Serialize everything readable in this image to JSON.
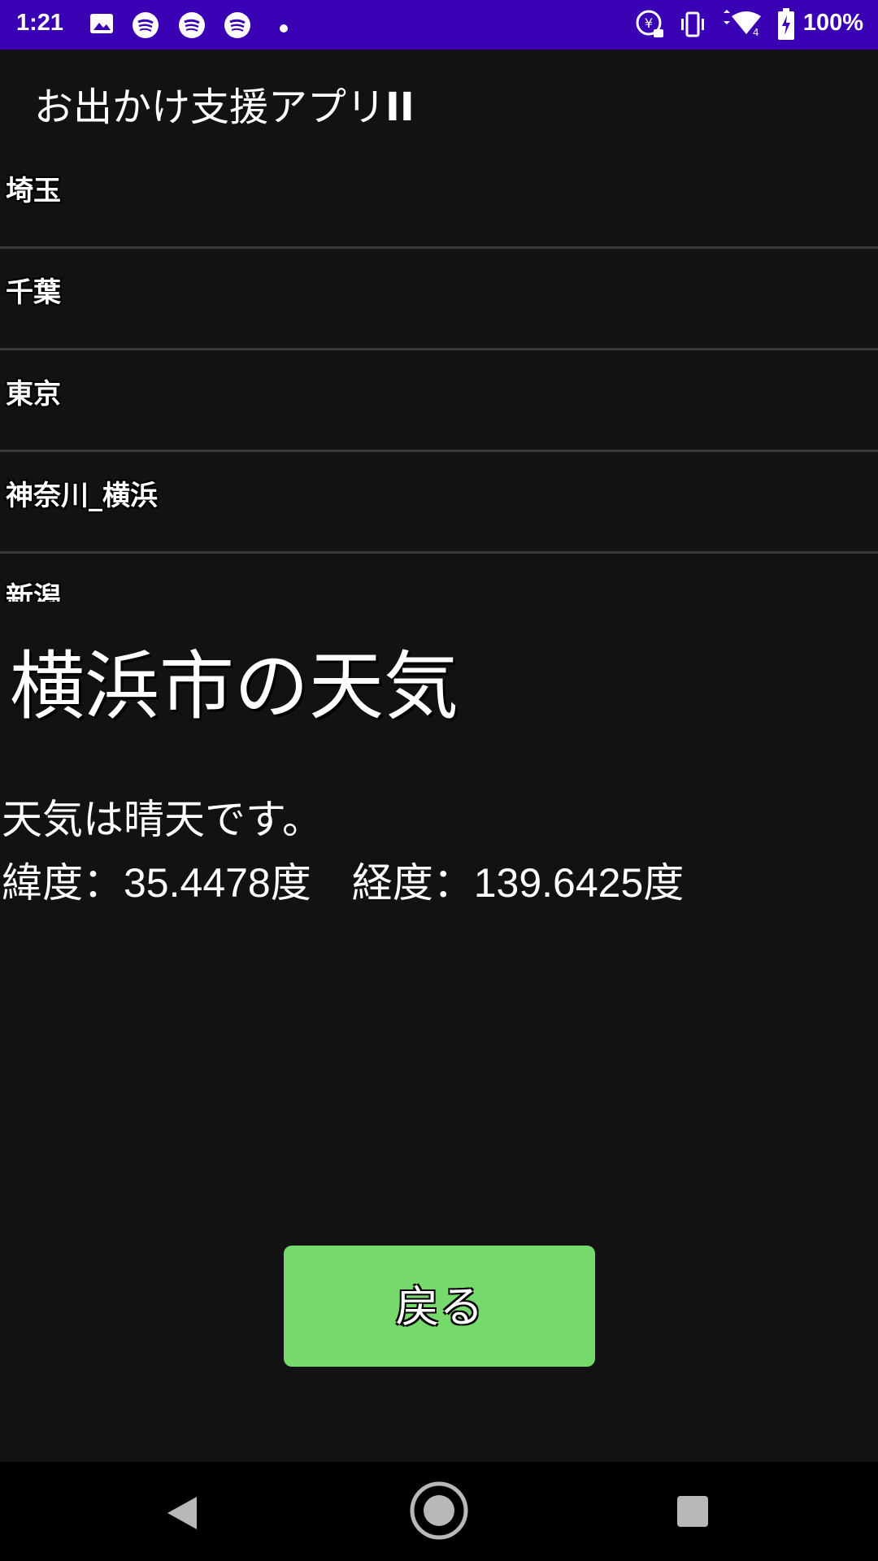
{
  "status_bar": {
    "time": "1:21",
    "battery_percent": "100%",
    "icons": [
      "image-icon",
      "spotify-icon",
      "spotify-icon",
      "spotify-icon",
      "dot-icon",
      "data-saver-icon",
      "vibrate-icon",
      "wifi-icon",
      "battery-charging-icon"
    ]
  },
  "app": {
    "title": "お出かけ支援アプリ",
    "title_suffix": "II"
  },
  "list": {
    "items": [
      {
        "label": "埼玉"
      },
      {
        "label": "千葉"
      },
      {
        "label": "東京"
      },
      {
        "label": "神奈川_横浜"
      },
      {
        "label": "新潟"
      }
    ]
  },
  "weather": {
    "title": "横浜市の天気",
    "description": "天気は晴天です。",
    "coordinates": "緯度：35.4478度　経度：139.6425度"
  },
  "back_button": {
    "label": "戻る",
    "color": "#76d96b"
  },
  "colors": {
    "status_bar": "#3a00b3",
    "background": "#121212"
  }
}
